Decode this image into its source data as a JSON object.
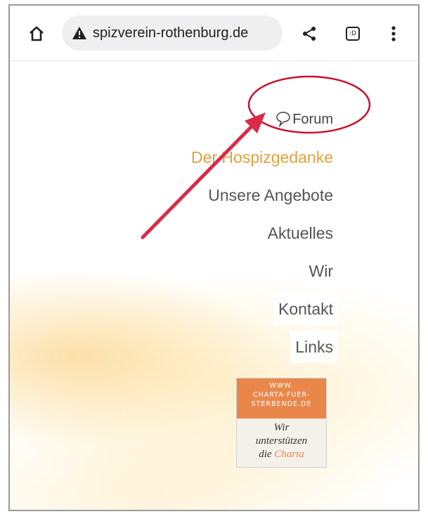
{
  "browser": {
    "url": "spizverein-rothenburg.de",
    "tabs_count": ":D",
    "icons": {
      "home": "home-icon",
      "warning": "warning-icon",
      "share": "share-icon",
      "tabs": "tabs-icon",
      "menu": "more-vert-icon"
    }
  },
  "nav": {
    "forum": "Forum",
    "items": [
      "Der Hospizgedanke",
      "Unsere Angebote",
      "Aktuelles",
      "Wir",
      "Kontakt",
      "Links"
    ],
    "active_index": 0
  },
  "charta": {
    "line1": "WWW.",
    "line2": "CHARTA-FUER-",
    "line3": "STERBENDE.DE",
    "text1": "Wir",
    "text2": "unterstützen",
    "text3_prefix": "die",
    "text3_accent": "Charta"
  },
  "colors": {
    "accent_orange": "#e1a13d",
    "charta_orange": "#e9874a",
    "annotation_red": "#c8102e",
    "arrow_red": "#d92b48"
  }
}
